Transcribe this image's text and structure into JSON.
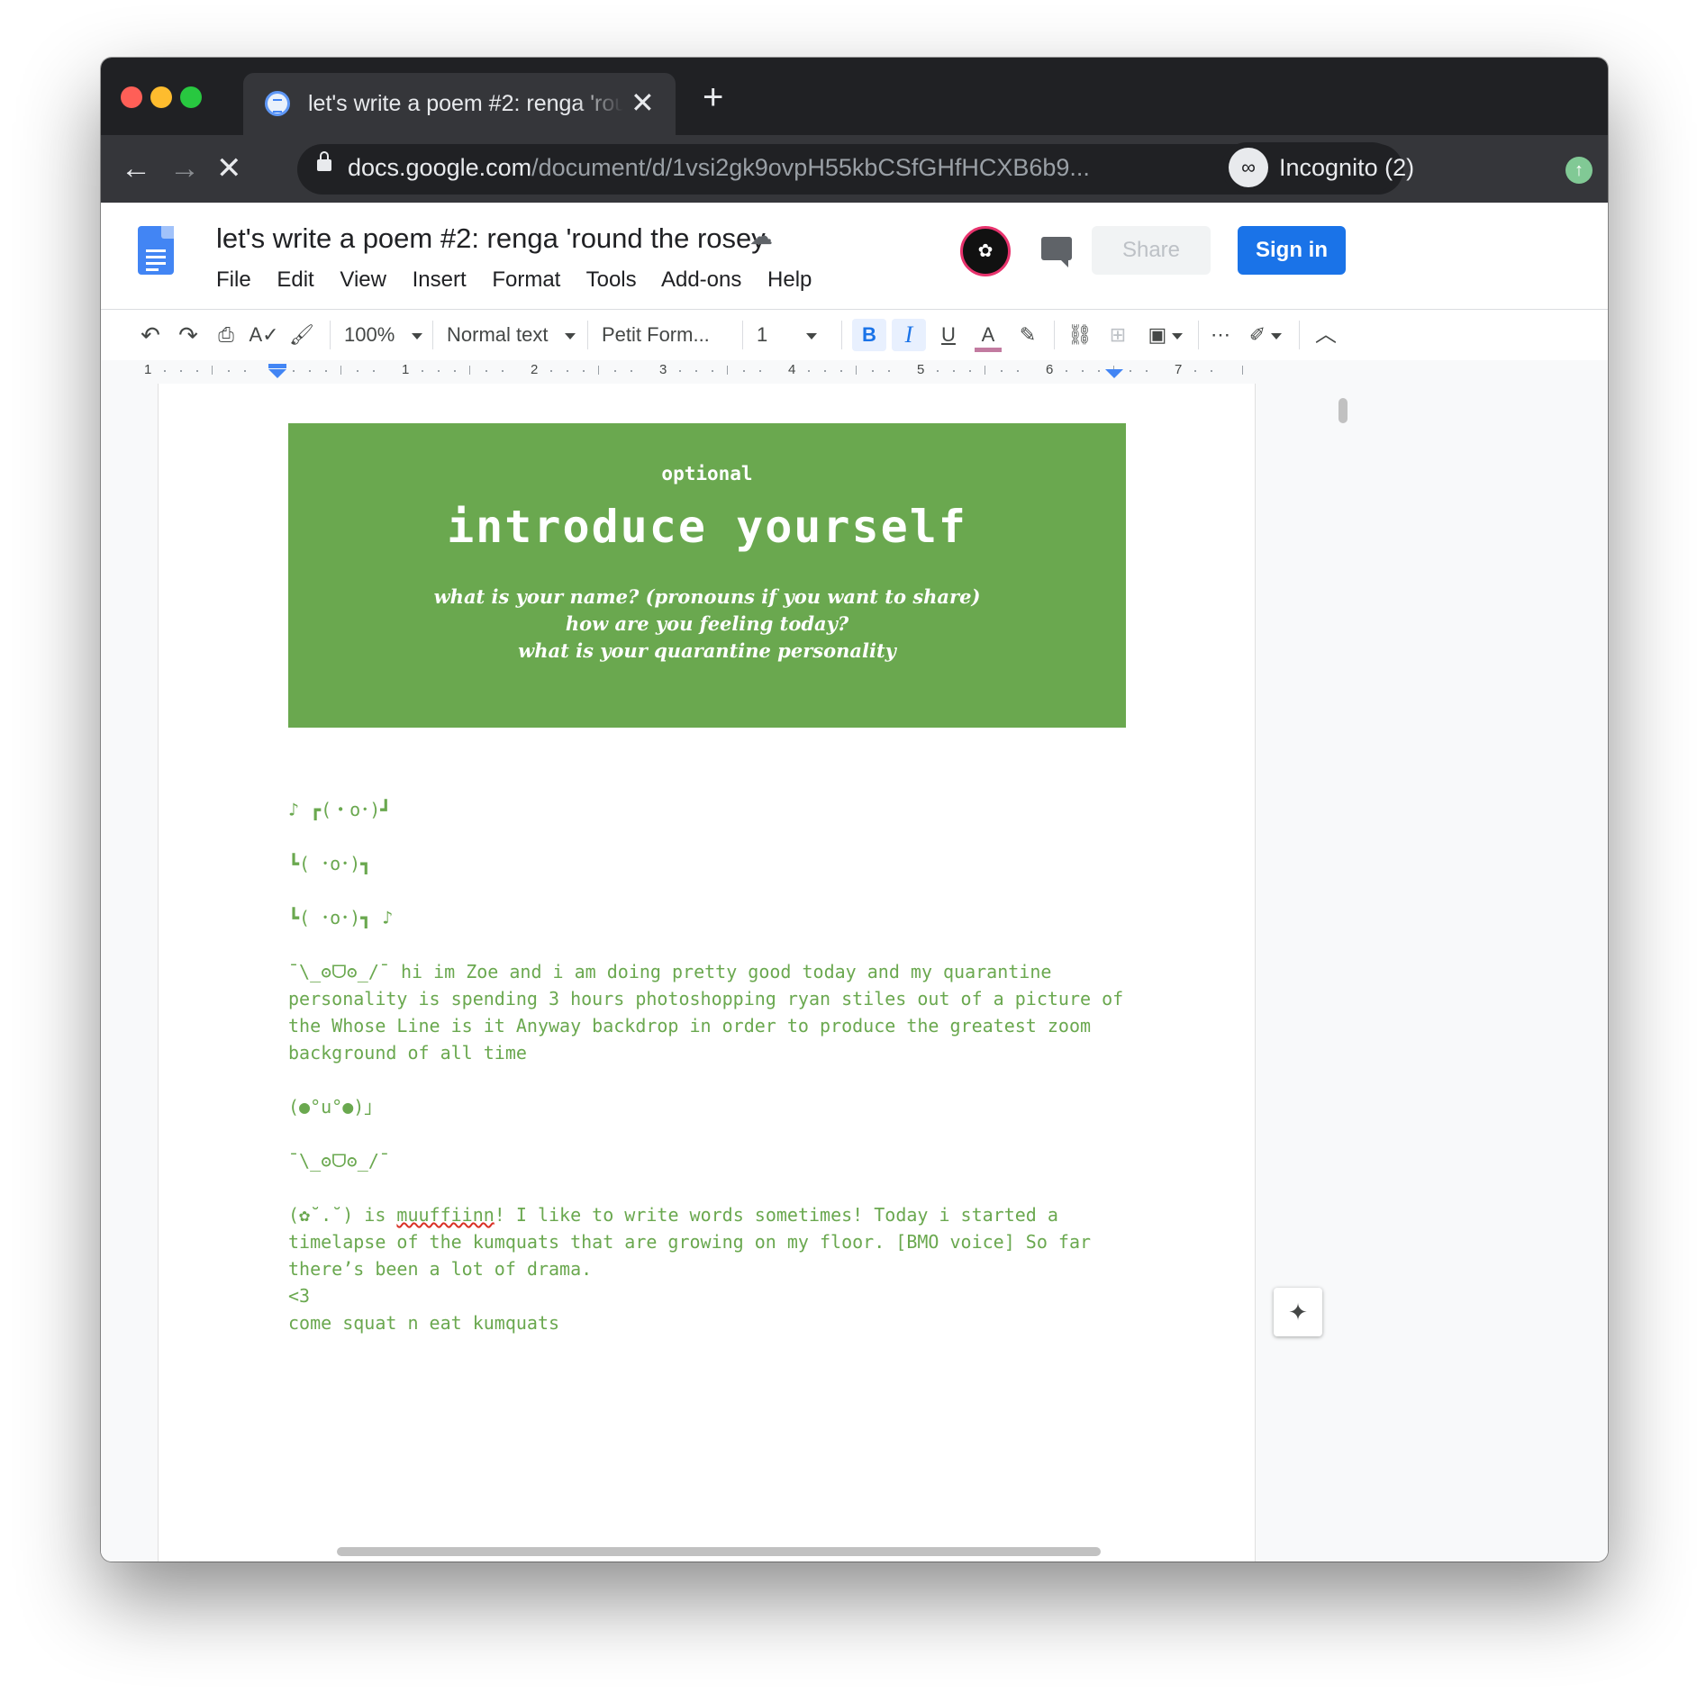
{
  "browser": {
    "tab_title": "let's write a poem #2: renga 'round the rosey",
    "tab_close": "✕",
    "new_tab": "+",
    "url_host": "docs.google.com",
    "url_path": "/document/d/1vsi2gk9ovpH55kbCSfGHfHCXB6b9...",
    "incognito_label": "Incognito (2)",
    "back": "←",
    "forward": "→",
    "stop": "✕"
  },
  "docs": {
    "title": "let's write a poem #2: renga 'round the rosey",
    "menu": [
      "File",
      "Edit",
      "View",
      "Insert",
      "Format",
      "Tools",
      "Add-ons",
      "Help"
    ],
    "share_label": "Share",
    "signin_label": "Sign in"
  },
  "toolbar": {
    "zoom": "100%",
    "style": "Normal text",
    "font": "Petit Form...",
    "font_size": "1",
    "bold": "B",
    "italic": "I",
    "underline": "U",
    "text_color": "A",
    "text_color_swatch": "#c27ba0"
  },
  "ruler": {
    "numbers": [
      "1",
      "1",
      "2",
      "3",
      "4",
      "5",
      "6",
      "7"
    ]
  },
  "banner": {
    "optional": "optional",
    "heading": "introduce yourself",
    "q1": "what is your name? (pronouns if you want to share)",
    "q2": "how are you feeling today?",
    "q3": "what is your quarantine personality",
    "background": "#6aa84f"
  },
  "content": {
    "line1": "♪ ┏(・o･)┛",
    "line2": "┗( ･o･)┓",
    "line3": "┗( ･o･)┓ ♪",
    "para1": "¯\\_ʘᗜʘ_/¯ hi im Zoe and i am doing pretty good today and my quarantine personality is spending 3 hours photoshopping ryan stiles out of a picture of the Whose Line is it Anyway backdrop in order to produce the greatest zoom background of all time",
    "line4": "(●°u°●)」",
    "line5": "¯\\_ʘᗜʘ_/¯",
    "para2_prefix": "(✿˘.˘) is ",
    "para2_misspelled": "muuffiinn",
    "para2_rest": "! I like to write words sometimes!  Today i started a timelapse of the kumquats that are growing on my floor.  [BMO voice] So far there’s been a lot of drama.",
    "line6": "<3",
    "line7": "come squat n eat kumquats",
    "text_color": "#6aa84f"
  }
}
